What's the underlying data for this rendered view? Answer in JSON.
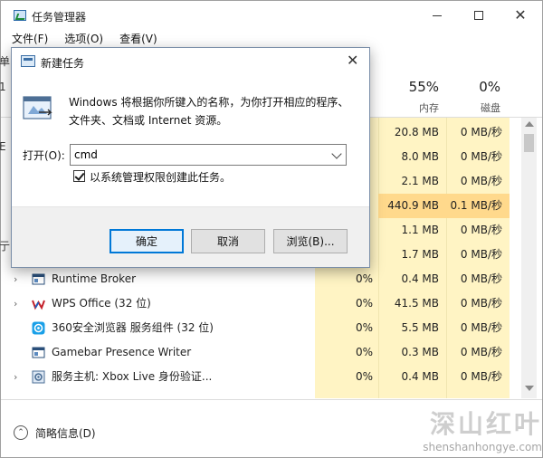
{
  "task_manager": {
    "title": "任务管理器",
    "menu": [
      "文件(F)",
      "选项(O)",
      "查看(V)"
    ],
    "columns": {
      "cpu": {
        "pct": "",
        "label": ""
      },
      "memory": {
        "pct": "55%",
        "label": "内存"
      },
      "disk": {
        "pct": "0%",
        "label": "磁盘"
      }
    },
    "rows_behind_dialog": [
      {
        "mem": "20.8 MB",
        "disk": "0 MB/秒"
      },
      {
        "mem": "8.0 MB",
        "disk": "0 MB/秒"
      },
      {
        "mem": "2.1 MB",
        "disk": "0 MB/秒"
      },
      {
        "mem": "440.9 MB",
        "disk": "0.1 MB/秒",
        "highlight": true
      },
      {
        "mem": "1.1 MB",
        "disk": "0 MB/秒"
      },
      {
        "mem": "1.7 MB",
        "disk": "0 MB/秒"
      }
    ],
    "processes": [
      {
        "name": "Runtime Broker",
        "cpu": "0%",
        "mem": "0.4 MB",
        "disk": "0 MB/秒",
        "expander": "›",
        "icon": "runtime-broker-icon"
      },
      {
        "name": "WPS Office (32 位)",
        "cpu": "0%",
        "mem": "41.5 MB",
        "disk": "0 MB/秒",
        "expander": "›",
        "icon": "wps-office-icon"
      },
      {
        "name": "360安全浏览器 服务组件 (32 位)",
        "cpu": "0%",
        "mem": "5.5 MB",
        "disk": "0 MB/秒",
        "expander": "",
        "icon": "360-browser-icon"
      },
      {
        "name": "Gamebar Presence Writer",
        "cpu": "0%",
        "mem": "0.3 MB",
        "disk": "0 MB/秒",
        "expander": "",
        "icon": "gamebar-icon"
      },
      {
        "name": "服务主机: Xbox Live 身份验证...",
        "cpu": "0%",
        "mem": "0.4 MB",
        "disk": "0 MB/秒",
        "expander": "›",
        "icon": "service-host-icon"
      }
    ],
    "fewer_details": "简略信息(D)",
    "partial_left_glyphs": [
      "单",
      "1",
      "E",
      "亍"
    ]
  },
  "run_dialog": {
    "title": "新建任务",
    "description_line1": "Windows 将根据你所键入的名称，为你打开相应的程序、",
    "description_line2": "文件夹、文档或 Internet 资源。",
    "open_label": "打开(O):",
    "open_value": "cmd",
    "admin_checkbox_label": "以系统管理权限创建此任务。",
    "admin_checked": true,
    "buttons": {
      "ok": "确定",
      "cancel": "取消",
      "browse": "浏览(B)..."
    }
  },
  "watermark": {
    "logo": "深山红叶",
    "url": "shenshanhongye.com"
  },
  "colors": {
    "usage_fill": "#fff4c4",
    "usage_high": "#ffd98c",
    "focus_blue": "#0078d7"
  }
}
